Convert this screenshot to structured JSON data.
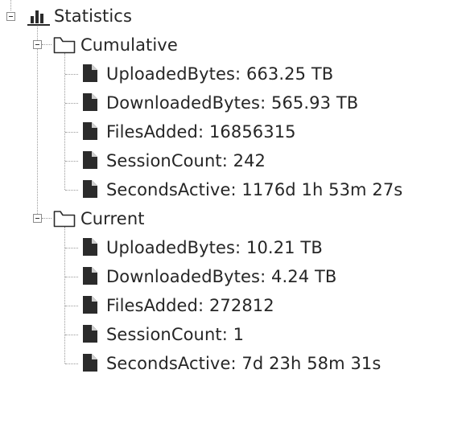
{
  "tree": {
    "root": {
      "label": "Statistics",
      "icon": "bar-chart-icon",
      "expanded": true
    },
    "cumulative": {
      "label": "Cumulative",
      "icon": "folder-icon",
      "expanded": true,
      "items": [
        {
          "text": "UploadedBytes: 663.25 TB",
          "icon": "file-icon"
        },
        {
          "text": "DownloadedBytes: 565.93 TB",
          "icon": "file-icon"
        },
        {
          "text": "FilesAdded: 16856315",
          "icon": "file-icon"
        },
        {
          "text": "SessionCount: 242",
          "icon": "file-icon"
        },
        {
          "text": "SecondsActive: 1176d 1h 53m 27s",
          "icon": "file-icon"
        }
      ]
    },
    "current": {
      "label": "Current",
      "icon": "folder-icon",
      "expanded": true,
      "items": [
        {
          "text": "UploadedBytes: 10.21 TB",
          "icon": "file-icon"
        },
        {
          "text": "DownloadedBytes: 4.24 TB",
          "icon": "file-icon"
        },
        {
          "text": "FilesAdded: 272812",
          "icon": "file-icon"
        },
        {
          "text": "SessionCount: 1",
          "icon": "file-icon"
        },
        {
          "text": "SecondsActive: 7d 23h 58m 31s",
          "icon": "file-icon"
        }
      ]
    }
  }
}
